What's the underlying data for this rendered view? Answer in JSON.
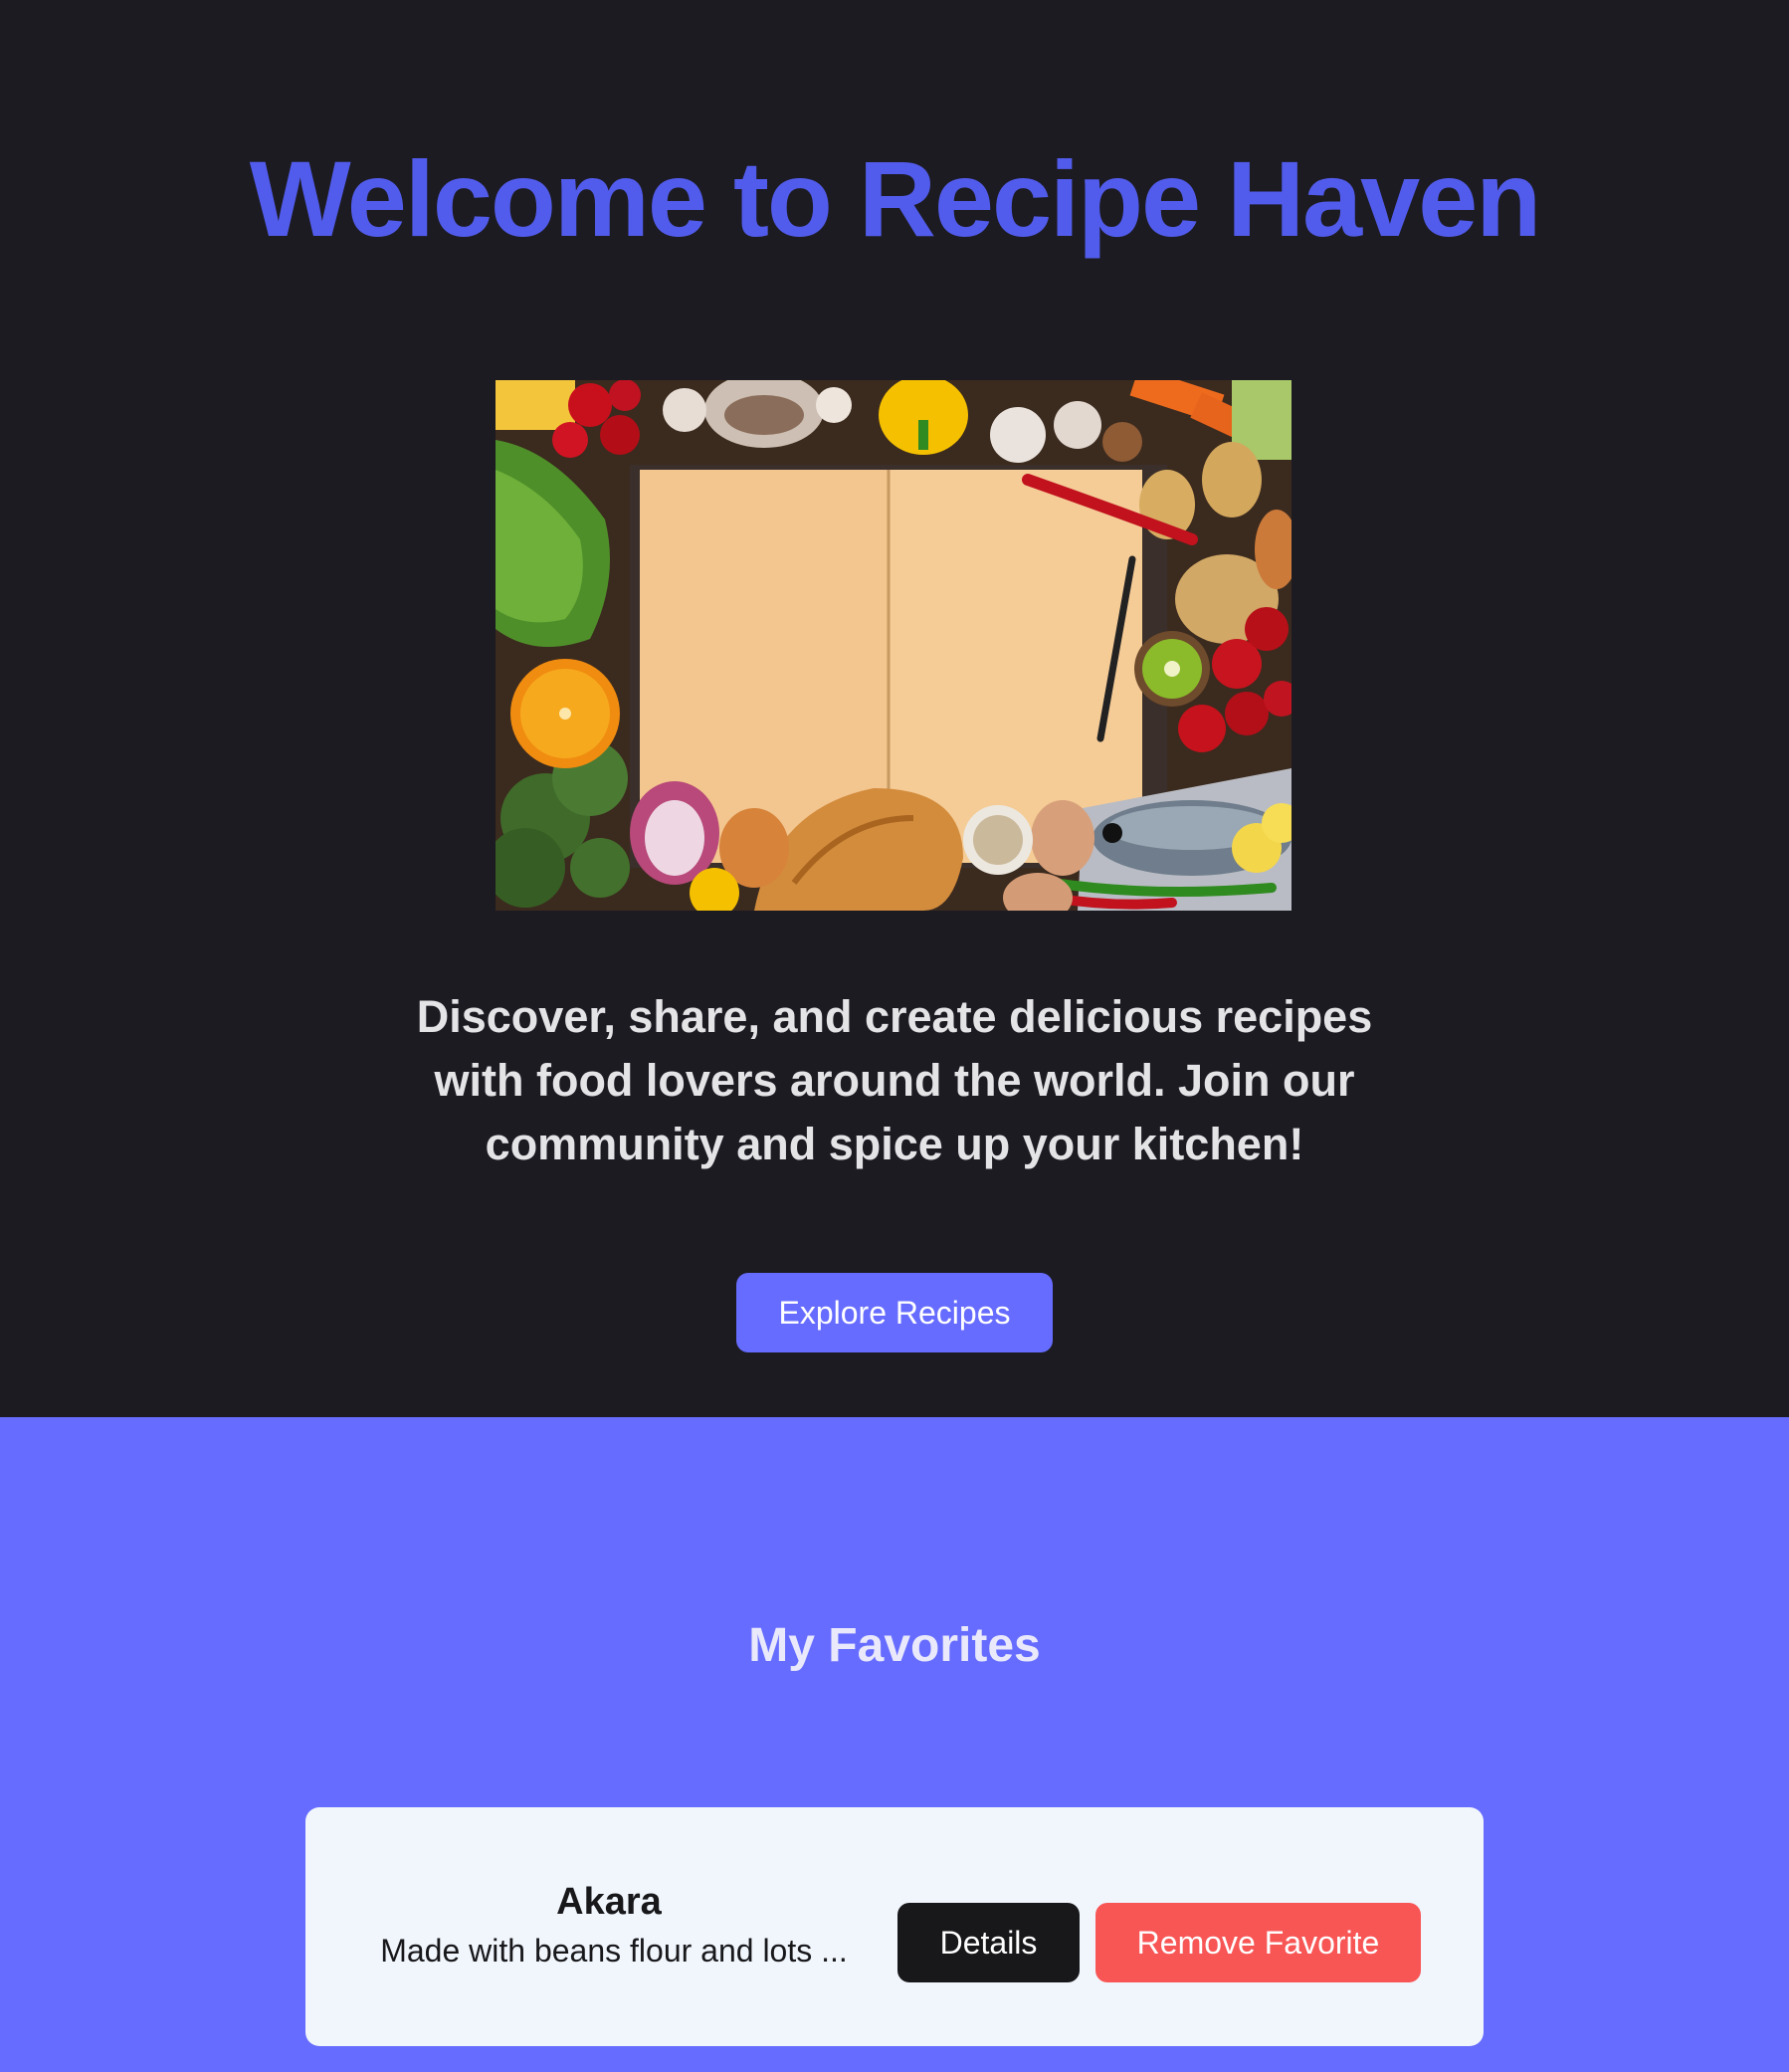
{
  "hero": {
    "title": "Welcome to Recipe Haven",
    "description": "Discover, share, and create delicious recipes with food lovers around the world. Join our community and spice up your kitchen!",
    "button_label": "Explore Recipes",
    "accent_color": "#525cec"
  },
  "favorites": {
    "title": "My Favorites",
    "background_color": "#666cff",
    "items": [
      {
        "name": "Akara",
        "description": "Made with beans flour and lots ...",
        "details_label": "Details",
        "remove_label": "Remove Favorite"
      }
    ]
  }
}
